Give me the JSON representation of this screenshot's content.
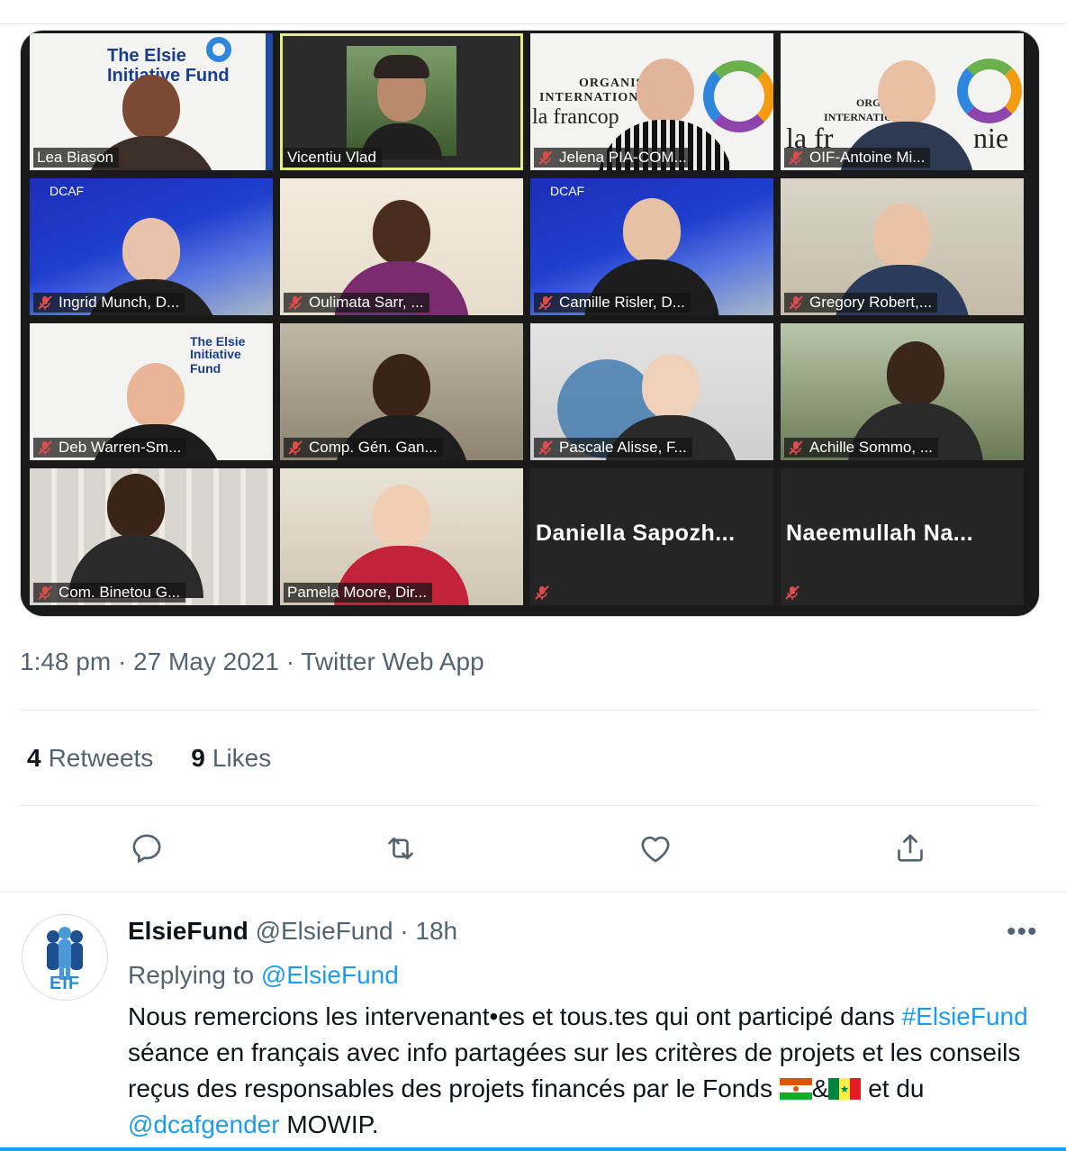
{
  "tweet": {
    "timestamp": "1:48 pm · 27 May 2021 · Twitter Web App",
    "retweets_count": "4",
    "retweets_label": "Retweets",
    "likes_count": "9",
    "likes_label": "Likes"
  },
  "video_call": {
    "participants": [
      {
        "name": "Lea Biason",
        "muted": false
      },
      {
        "name": "Vicentiu Vlad",
        "muted": false,
        "active_speaker": true
      },
      {
        "name": "Jelena PIA-COM...",
        "muted": true
      },
      {
        "name": "OIF-Antoine Mi...",
        "muted": true
      },
      {
        "name": "Ingrid Munch, D...",
        "muted": true
      },
      {
        "name": "Oulimata Sarr, ...",
        "muted": true
      },
      {
        "name": "Camille Risler, D...",
        "muted": true
      },
      {
        "name": "Gregory Robert,...",
        "muted": true
      },
      {
        "name": "Deb Warren-Sm...",
        "muted": true
      },
      {
        "name": "Comp. Gén. Gan...",
        "muted": true
      },
      {
        "name": "Pascale Alisse, F...",
        "muted": true
      },
      {
        "name": "Achille Sommo, ...",
        "muted": true
      },
      {
        "name": "Com. Binetou G...",
        "muted": true
      },
      {
        "name": "Pamela Moore, Dir...",
        "muted": false
      },
      {
        "name": "Daniella  Sapozh...",
        "muted": true,
        "video_off": true
      },
      {
        "name": "Naeemullah  Na...",
        "muted": true,
        "video_off": true
      }
    ],
    "logos": {
      "elsie_line1": "The Elsie",
      "elsie_line2": "Initiative Fund",
      "oif_line1": "ORGANISA",
      "oif_line2": "INTERNATIONAL",
      "oif_line3": "la francop",
      "oif2_line1": "ORGA",
      "oif2_line2": "INTERNATIO",
      "oif2_line3": "la fr",
      "oif2_line4": "nie",
      "dcaf": "DCAF"
    }
  },
  "reply": {
    "display_name": "ElsieFund",
    "handle": "@ElsieFund",
    "time": "· 18h",
    "avatar_label": "EIF",
    "replying_prefix": "Replying to",
    "replying_to": "@ElsieFund",
    "text_part1": "Nous remercions les intervenant•es et tous.tes qui ont participé dans",
    "hashtag": "#ElsieFund",
    "text_part2": " séance en français avec info partagées sur les critères de projets et les conseils reçus des responsables des projets financés par le Fonds ",
    "amp": "&",
    "text_part3": " et du ",
    "mention": "@dcafgender",
    "text_part4": " MOWIP."
  },
  "colors": {
    "accent": "#1d9bf0",
    "secondary_text": "#536471",
    "active_speaker_border": "#e3ef7a"
  }
}
